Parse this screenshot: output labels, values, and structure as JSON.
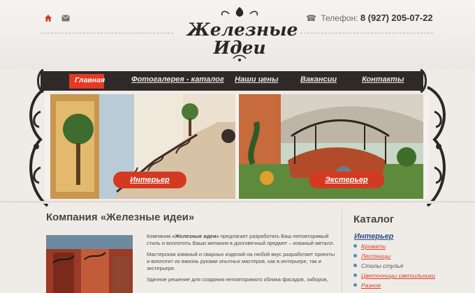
{
  "header": {
    "phone_label": "Телефон:",
    "phone_prefix": "8 (927)",
    "phone_number": "205-07-22",
    "logo_line1": "Железные",
    "logo_line2": "Идеи"
  },
  "nav": {
    "items": [
      {
        "label": "Главная"
      },
      {
        "label": "Фотогалерея - каталог"
      },
      {
        "label": "Наши цены"
      },
      {
        "label": "Вакансии"
      },
      {
        "label": "Контакты"
      }
    ]
  },
  "banner": {
    "interior_label": "Интерьер",
    "exterior_label": "Экстерьер"
  },
  "main": {
    "title": "Компания «Железные идеи»",
    "para1_prefix": "Компания ",
    "para1_bold": "«Железные идеи»",
    "para1_rest": " предлагает разработать Ваш неповторимый стиль и воплотить Ваши желания в долговечный предмет – кованый металл.",
    "para2": "Мастерская кованый и сварных изделий на любой вкус разработает проекты и воплотит их вжизнь руками опытных мастеров, как в интерьере, так и экстерьере.",
    "para3": "Удачное решение для создания неповторимого облика фасадов, заборов,"
  },
  "catalog": {
    "title": "Каталог",
    "section": "Интерьер",
    "items": [
      {
        "label": "Кровати"
      },
      {
        "label": "Лестницы"
      },
      {
        "label": "Столы стулья"
      },
      {
        "label": "Цветочницы светильники"
      },
      {
        "label": "Разное"
      }
    ]
  },
  "colors": {
    "accent": "#e23a25",
    "nav_bg": "#2f2a28",
    "link_blue": "#2f4e86"
  }
}
